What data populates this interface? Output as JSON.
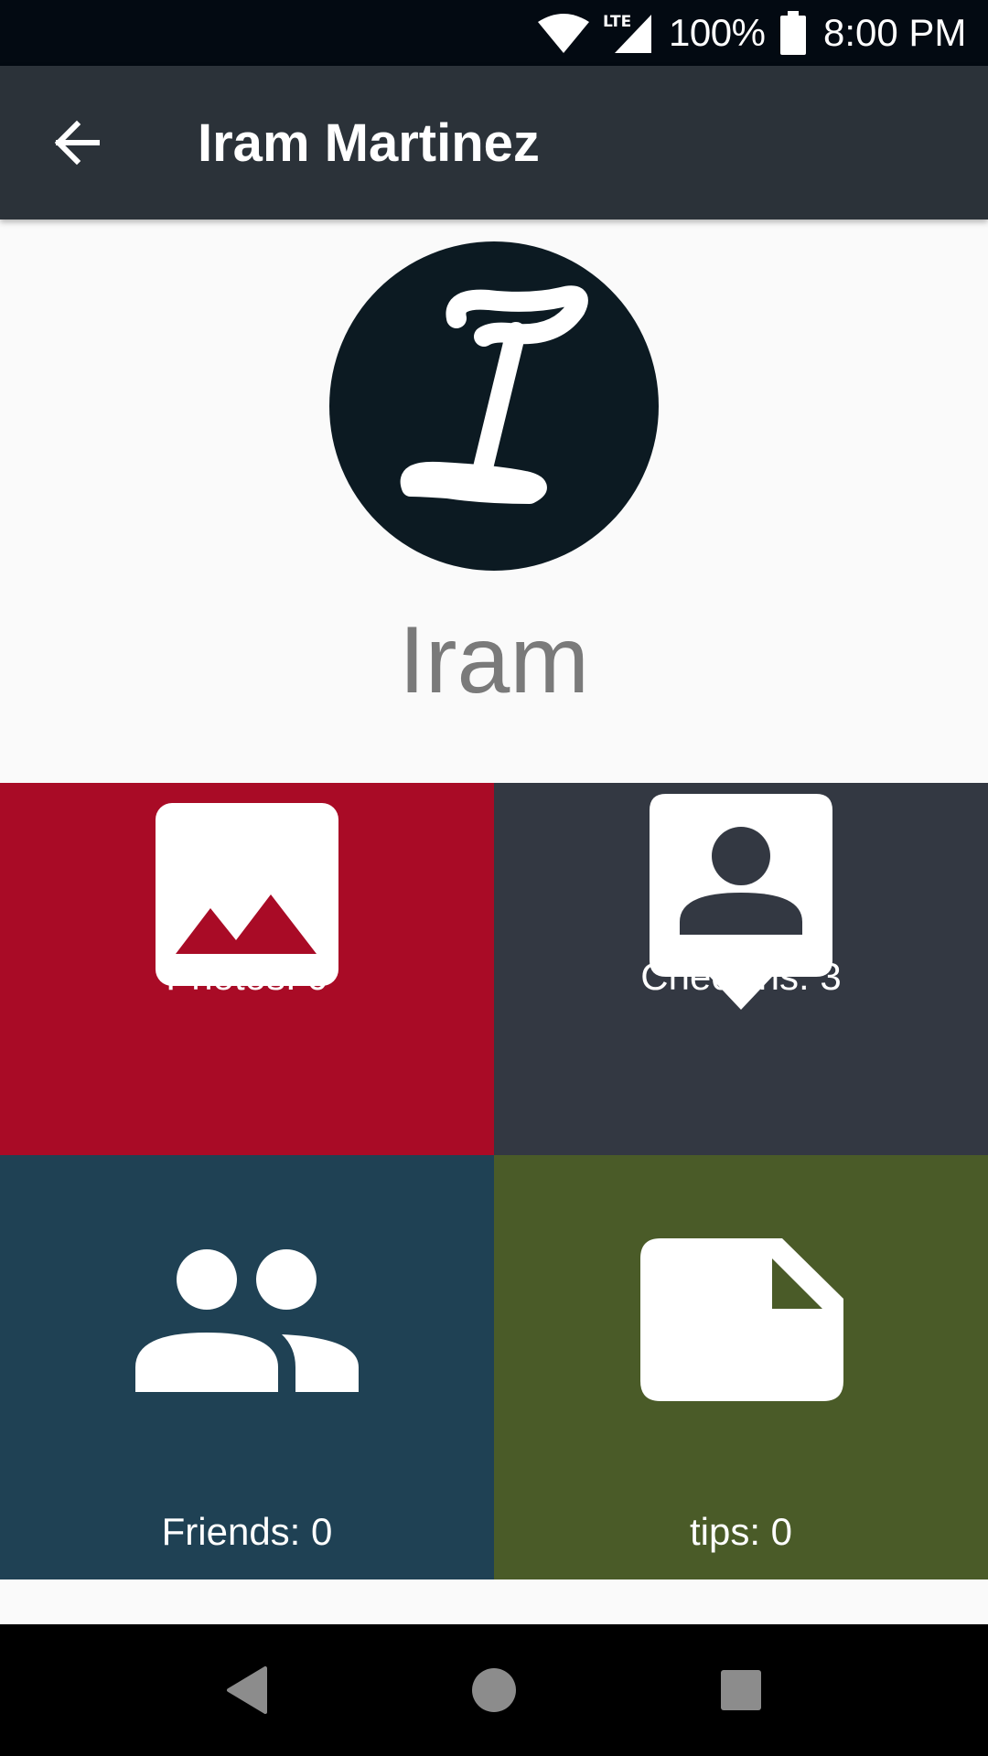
{
  "status_bar": {
    "wifi_icon": "wifi-icon",
    "network_label": "LTE",
    "battery_percent": "100%",
    "battery_icon": "battery-full-icon",
    "time": "8:00 PM"
  },
  "app_bar": {
    "back_icon": "arrow-back-icon",
    "title": "Iram Martinez"
  },
  "profile": {
    "avatar_letter": "I",
    "name": "Iram"
  },
  "tiles": [
    {
      "label": "Photos: 0",
      "icon": "photo-icon",
      "color": "#a90b26"
    },
    {
      "label": "Checkins: 3",
      "icon": "checkin-person-pin-icon",
      "color": "#333842"
    },
    {
      "label": "Friends: 0",
      "icon": "friends-group-icon",
      "color": "#1f4154"
    },
    {
      "label": "tips: 0",
      "icon": "note-icon",
      "color": "#4a5b28"
    }
  ],
  "nav_bar": {
    "back_icon": "nav-back-icon",
    "home_icon": "nav-home-icon",
    "recents_icon": "nav-recents-icon"
  }
}
